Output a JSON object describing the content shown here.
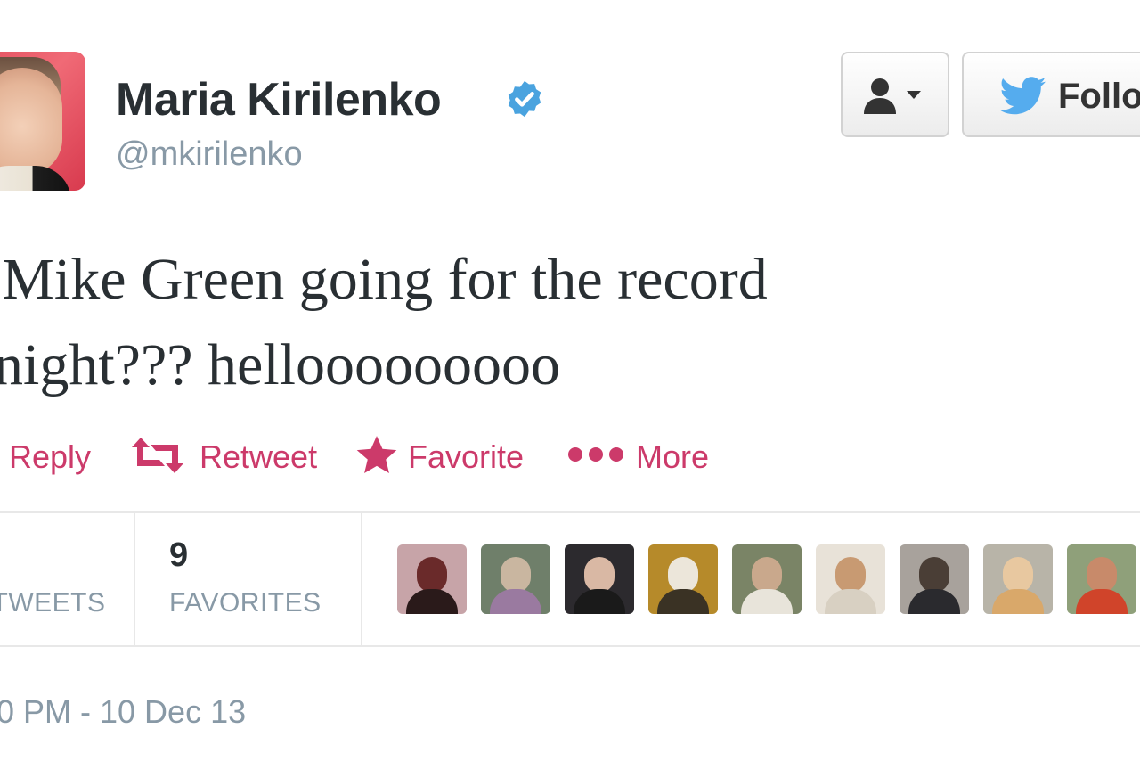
{
  "profile": {
    "name": "Maria Kirilenko",
    "handle": "@mkirilenko",
    "verified": true
  },
  "header_buttons": {
    "user_menu_icon": "user-dropdown-icon",
    "follow_icon": "twitter-bird-icon",
    "follow_label": "Follo"
  },
  "tweet": {
    "line1": "s Mike Green going for the record",
    "line2": "onight??? hellooooooooo"
  },
  "actions": {
    "reply": "Reply",
    "retweet": "Retweet",
    "favorite": "Favorite",
    "more": "More"
  },
  "stats": {
    "retweets_label": "ETWEETS",
    "favorites_count": "9",
    "favorites_label": "FAVORITES"
  },
  "favoriters": [
    {
      "icon": "favoriter-avatar-1"
    },
    {
      "icon": "favoriter-avatar-2"
    },
    {
      "icon": "favoriter-avatar-3"
    },
    {
      "icon": "favoriter-avatar-4"
    },
    {
      "icon": "favoriter-avatar-5"
    },
    {
      "icon": "favoriter-avatar-6"
    },
    {
      "icon": "favoriter-avatar-7"
    },
    {
      "icon": "favoriter-avatar-8"
    },
    {
      "icon": "favoriter-avatar-9"
    }
  ],
  "timestamp": "0 PM - 10 Dec 13",
  "colors": {
    "action": "#cc3a6a",
    "verified": "#4aa3df",
    "muted": "#8899a6",
    "bird": "#55acee"
  }
}
